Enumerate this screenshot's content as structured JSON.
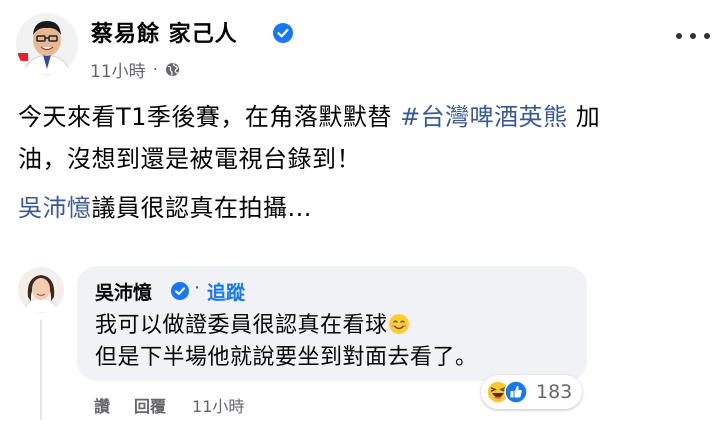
{
  "post": {
    "author": "蔡易餘 家己人",
    "time": "11小時",
    "separator": "·",
    "line1_pre": "今天來看T1季後賽，在角落默默替 ",
    "hashtag": "#台灣啤酒英熊",
    "line1_post": " 加",
    "line2": "油，沒想到還是被電視台錄到！",
    "mention": "吳沛憶",
    "line3_post": "議員很認真在拍攝..."
  },
  "comment": {
    "author": "吳沛憶",
    "separator": "·",
    "follow_label": "追蹤",
    "line1": "我可以做證委員很認真在看球",
    "line2": "但是下半場他就說要坐到對面去看了。",
    "reaction_count": "183",
    "reaction_icons": [
      "haha-icon",
      "like-icon"
    ],
    "actions": {
      "like": "讚",
      "reply": "回覆",
      "time": "11小時"
    }
  },
  "colors": {
    "link": "#385898",
    "follow": "#1877f2",
    "verified": "#1877f2",
    "meta": "#65676b",
    "bubble": "#f0f2f5"
  }
}
